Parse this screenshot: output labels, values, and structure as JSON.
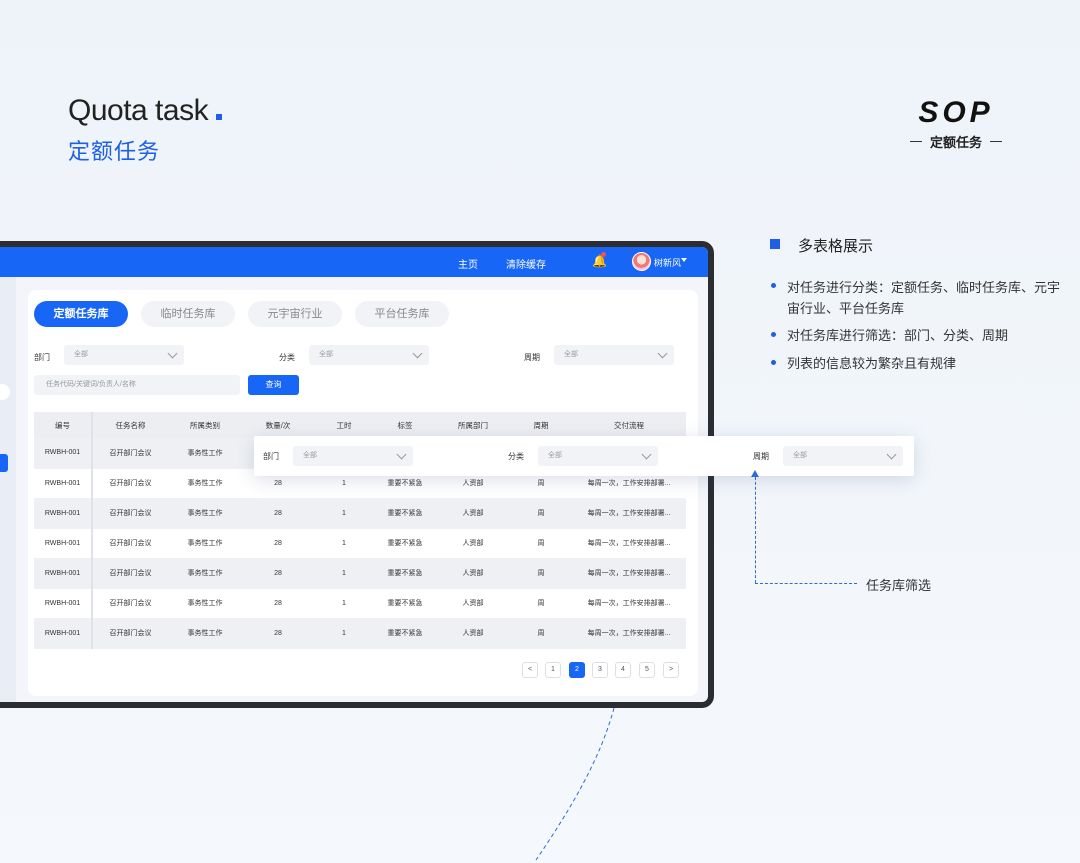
{
  "header": {
    "title_en": "Quota task",
    "title_cn": "定额任务"
  },
  "brand": {
    "logo": "SOP",
    "subtitle": "定额任务"
  },
  "appbar": {
    "nav_home": "主页",
    "nav_clear_cache": "清除缓存",
    "username": "树新风"
  },
  "tabs": [
    {
      "label": "定额任务库",
      "active": true
    },
    {
      "label": "临时任务库",
      "active": false
    },
    {
      "label": "元宇宙行业",
      "active": false
    },
    {
      "label": "平台任务库",
      "active": false
    }
  ],
  "filters": {
    "dept_label": "部门",
    "dept_value": "全部",
    "category_label": "分类",
    "category_value": "全部",
    "period_label": "周期",
    "period_value": "全部",
    "search_placeholder": "任务代码/关键词/负责人/名称",
    "query_button": "查询"
  },
  "table": {
    "columns": [
      "编号",
      "任务名称",
      "所属类别",
      "数量/次",
      "工时",
      "标签",
      "所属部门",
      "周期",
      "交付流程"
    ],
    "rows": [
      [
        "RWBH-001",
        "召开部门会议",
        "事务性工作",
        "",
        "",
        "",
        "",
        "",
        ""
      ],
      [
        "RWBH-001",
        "召开部门会议",
        "事务性工作",
        "28",
        "1",
        "重要不紧急",
        "人资部",
        "周",
        "每周一次，工作安排部署..."
      ],
      [
        "RWBH-001",
        "召开部门会议",
        "事务性工作",
        "28",
        "1",
        "重要不紧急",
        "人资部",
        "周",
        "每周一次，工作安排部署..."
      ],
      [
        "RWBH-001",
        "召开部门会议",
        "事务性工作",
        "28",
        "1",
        "重要不紧急",
        "人资部",
        "周",
        "每周一次，工作安排部署..."
      ],
      [
        "RWBH-001",
        "召开部门会议",
        "事务性工作",
        "28",
        "1",
        "重要不紧急",
        "人资部",
        "周",
        "每周一次，工作安排部署..."
      ],
      [
        "RWBH-001",
        "召开部门会议",
        "事务性工作",
        "28",
        "1",
        "重要不紧急",
        "人资部",
        "周",
        "每周一次，工作安排部署..."
      ],
      [
        "RWBH-001",
        "召开部门会议",
        "事务性工作",
        "28",
        "1",
        "重要不紧急",
        "人资部",
        "周",
        "每周一次，工作安排部署..."
      ]
    ]
  },
  "pagination": {
    "prev": "<",
    "pages": [
      "1",
      "2",
      "3",
      "4",
      "5"
    ],
    "current": "2",
    "next": ">"
  },
  "popup_filter": {
    "dept_label": "部门",
    "dept_value": "全部",
    "category_label": "分类",
    "category_value": "全部",
    "period_label": "周期",
    "period_value": "全部"
  },
  "explain": {
    "section_title": "多表格展示",
    "bullets": [
      "对任务进行分类：定额任务、临时任务库、元宇宙行业、平台任务库",
      "对任务库进行筛选：部门、分类、周期",
      "列表的信息较为繁杂且有规律"
    ],
    "annotation": "任务库筛选"
  },
  "colors": {
    "accent": "#1766f5",
    "brand_blue": "#1d5fe6",
    "device_frame": "#2b2d33"
  }
}
